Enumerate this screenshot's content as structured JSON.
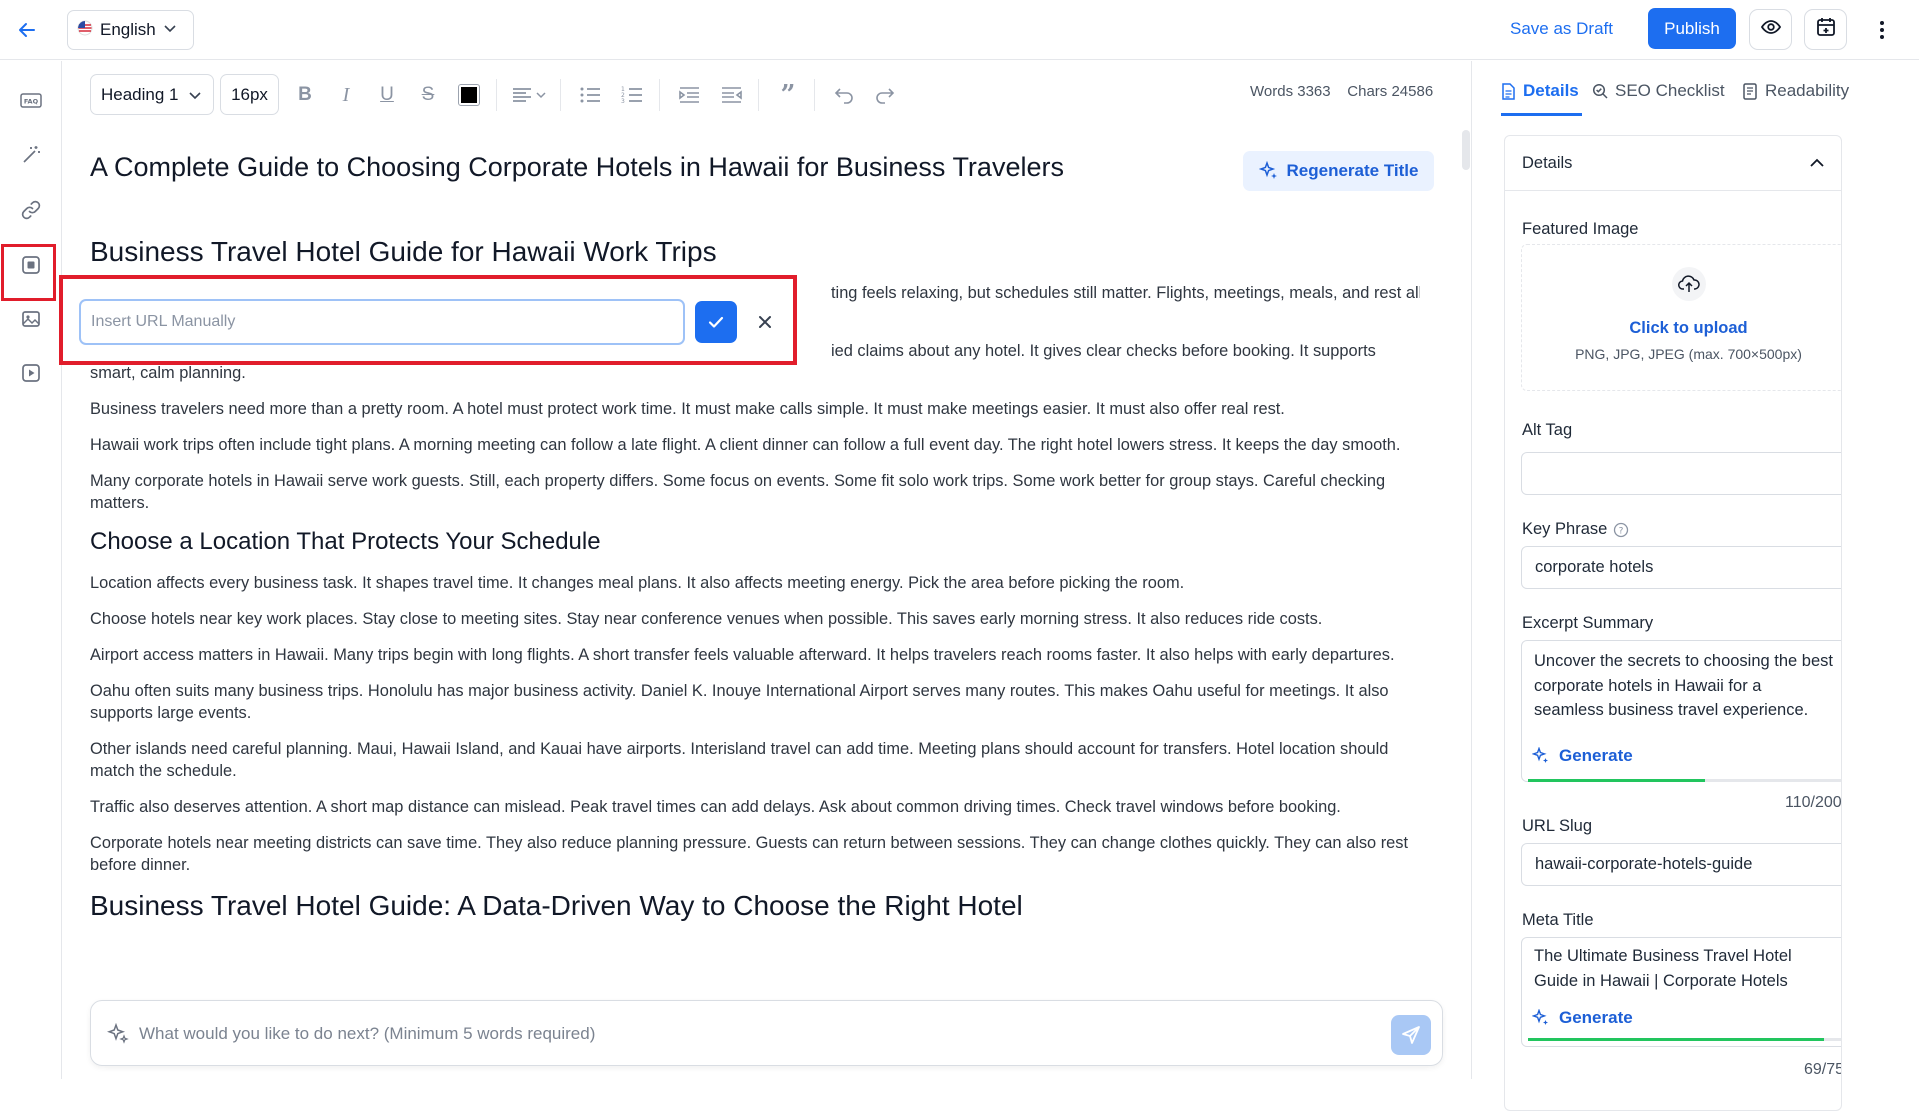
{
  "topbar": {
    "language": "English",
    "save_draft": "Save as Draft",
    "publish": "Publish"
  },
  "toolbar": {
    "block_style": "Heading 1",
    "font_size": "16px",
    "text_color": "#000000",
    "words_label": "Words 3363",
    "chars_label": "Chars 24586"
  },
  "editor": {
    "title": "A Complete Guide to Choosing Corporate Hotels in Hawaii for Business Travelers",
    "regenerate_title": "Regenerate Title",
    "heading1": "Business Travel Hotel Guide for Hawaii Work Trips",
    "p1": "ting feels relaxing, but schedules still matter. Flights, meetings, meals, and rest all",
    "p2": "ied claims about any hotel. It gives clear checks before booking. It supports smart, calm planning.",
    "p3": "Business travelers need more than a pretty room. A hotel must protect work time. It must make calls simple. It must make meetings easier. It must also offer real rest.",
    "p4": "Hawaii work trips often include tight plans. A morning meeting can follow a late flight. A client dinner can follow a full event day. The right hotel lowers stress. It keeps the day smooth.",
    "p5": "Many corporate hotels in Hawaii serve work guests. Still, each property differs. Some focus on events. Some fit solo work trips. Some work better for group stays. Careful checking matters.",
    "heading2": "Choose a Location That Protects Your Schedule",
    "p6": "Location affects every business task. It shapes travel time. It changes meal plans. It also affects meeting energy. Pick the area before picking the room.",
    "p7": "Choose hotels near key work places. Stay close to meeting sites. Stay near conference venues when possible. This saves early morning stress. It also reduces ride costs.",
    "p8": "Airport access matters in Hawaii. Many trips begin with long flights. A short transfer feels valuable afterward. It helps travelers reach rooms faster. It also helps with early departures.",
    "p9": "Oahu often suits many business trips. Honolulu has major business activity. Daniel K. Inouye International Airport serves many routes. This makes Oahu useful for meetings. It also supports large events.",
    "p10": "Other islands need careful planning. Maui, Hawaii Island, and Kauai have airports. Interisland travel can add time. Meeting plans should account for transfers. Hotel location should match the schedule.",
    "p11": "Traffic also deserves attention. A short map distance can mislead. Peak travel times can add delays. Ask about common driving times. Check travel windows before booking.",
    "p12": "Corporate hotels near meeting districts can save time. They also reduce planning pressure. Guests can return between sessions. They can change clothes quickly. They can also rest before dinner.",
    "heading3": "Business Travel Hotel Guide: A Data-Driven Way to Choose the Right Hotel"
  },
  "url_popup": {
    "placeholder": "Insert URL Manually"
  },
  "prompt": {
    "placeholder": "What would you like to do next? (Minimum 5 words required)"
  },
  "panel": {
    "tabs": [
      "Details",
      "SEO Checklist",
      "Readability"
    ],
    "section_title": "Details",
    "featured_image_label": "Featured Image",
    "upload_link": "Click to upload",
    "upload_hint": "PNG, JPG, JPEG (max. 700×500px)",
    "alt_tag_label": "Alt Tag",
    "alt_tag_value": "",
    "key_phrase_label": "Key Phrase",
    "key_phrase_value": "corporate hotels",
    "excerpt_label": "Excerpt Summary",
    "excerpt_value": "Uncover the secrets to choosing the best corporate hotels in Hawaii for a seamless business travel experience.",
    "generate": "Generate",
    "excerpt_count": "110/200",
    "excerpt_progress": 0.55,
    "slug_label": "URL Slug",
    "slug_value": "hawaii-corporate-hotels-guide",
    "meta_title_label": "Meta Title",
    "meta_title_value": "The Ultimate Business Travel Hotel Guide in Hawaii | Corporate Hotels",
    "meta_title_count": "69/75",
    "meta_title_progress": 0.92
  },
  "colors": {
    "accent": "#1d6ef0",
    "highlight": "#e11d2b",
    "progress": "#22c55e"
  }
}
